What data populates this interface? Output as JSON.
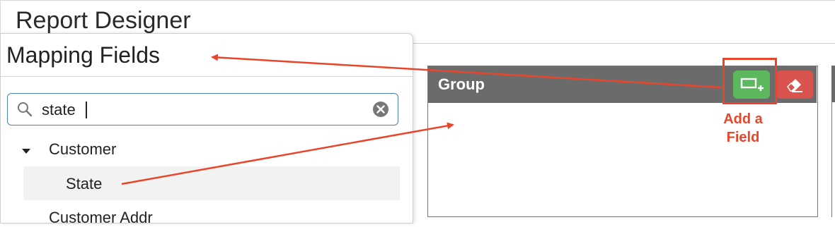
{
  "window": {
    "title": "Report Designer"
  },
  "mapping_fields": {
    "title": "Mapping Fields",
    "search": {
      "value": "state",
      "icon": "search-icon",
      "clear_icon": "clear-circle-icon"
    },
    "tree": {
      "group_label": "Customer",
      "item_label": "State",
      "next_group_label": "Customer Addr"
    }
  },
  "group_panel": {
    "title": "Group",
    "add_field_icon": "add-field-icon",
    "erase_icon": "eraser-icon"
  },
  "annotation": {
    "label_line1": "Add a",
    "label_line2": "Field",
    "color": "#e8452a"
  }
}
